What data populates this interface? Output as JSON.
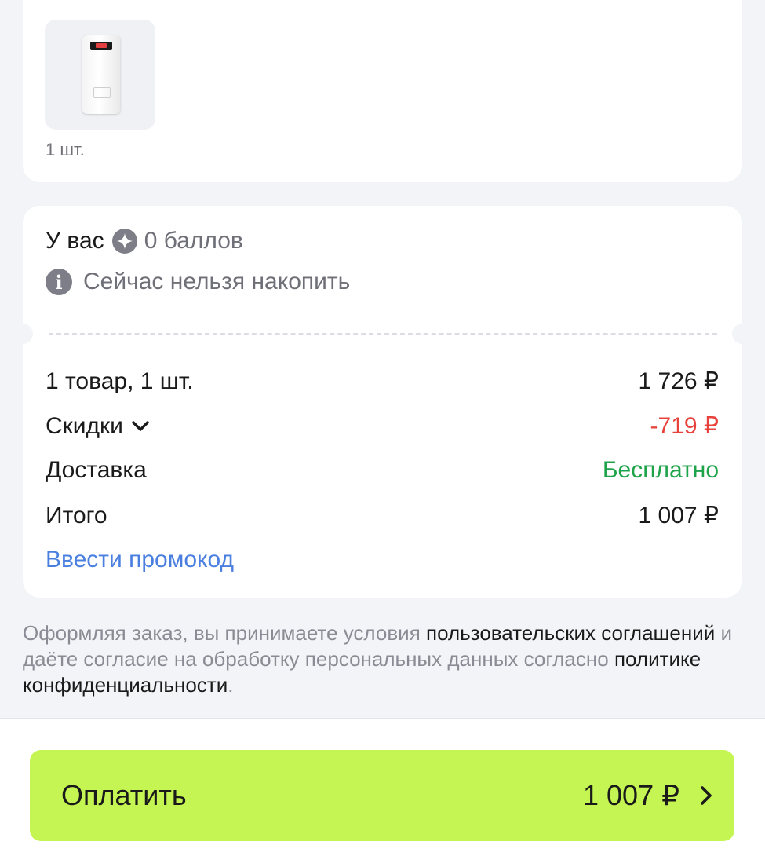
{
  "product": {
    "image_alt": "power bank",
    "quantity": "1 шт."
  },
  "points": {
    "prefix": "У вас",
    "balance": "0 баллов",
    "info": "Сейчас нельзя накопить"
  },
  "summary": {
    "items_label": "1 товар, 1 шт.",
    "items_value": "1 726 ₽",
    "discount_label": "Скидки",
    "discount_value": "-719 ₽",
    "delivery_label": "Доставка",
    "delivery_value": "Бесплатно",
    "total_label": "Итого",
    "total_value": "1 007 ₽",
    "promo_link": "Ввести промокод"
  },
  "legal": {
    "text_1": "Оформляя заказ, вы принимаете условия ",
    "link_1": "пользовательских соглашений",
    "text_2": " и даёте согласие на обработку персональных данных согласно ",
    "link_2": "политике конфиденциальности",
    "text_3": "."
  },
  "pay_button": {
    "label": "Оплатить",
    "amount": "1 007 ₽"
  },
  "colors": {
    "accent_button": "#c4f552",
    "discount": "#e8403a",
    "free_delivery": "#1fa34a",
    "link": "#4a7fe0"
  }
}
